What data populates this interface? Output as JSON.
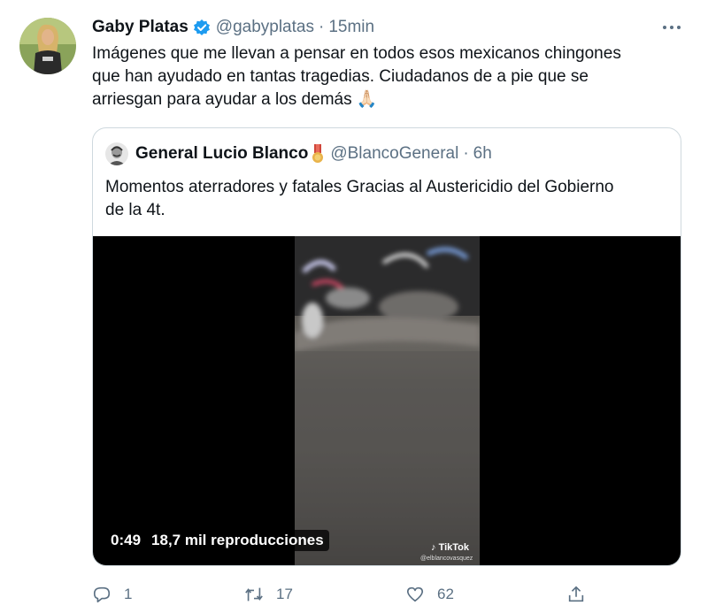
{
  "author": {
    "name": "Gaby Platas",
    "handle": "@gabyplatas",
    "separator": "·",
    "time": "15min"
  },
  "tweet": {
    "lines": [
      "Imágenes que me llevan a pensar en todos esos mexicanos chingones",
      "que han ayudado en tantas tragedias. Ciudadanos de a pie que se",
      "arriesgan para ayudar a los demás"
    ],
    "emoji": "🙏🏻"
  },
  "quoted": {
    "name": "General Lucio Blanco",
    "handle": "@BlancoGeneral",
    "separator": "·",
    "time": "6h",
    "lines": [
      "Momentos aterradores y fatales Gracias al Austericidio del Gobierno",
      "de la 4t."
    ],
    "video": {
      "duration": "0:49",
      "views": "18,7 mil reproducciones",
      "watermark": "TikTok",
      "watermark_handle": "@elblancovasquez"
    }
  },
  "actions": {
    "replies": "1",
    "retweets": "17",
    "likes": "62"
  },
  "colors": {
    "text": "#0f1419",
    "secondary": "#5b7083",
    "verified": "#1d9bf0",
    "border": "#cfd9de"
  },
  "icons": [
    "verified-icon",
    "more-icon",
    "medal-icon",
    "reply-icon",
    "retweet-icon",
    "like-icon",
    "share-icon"
  ]
}
